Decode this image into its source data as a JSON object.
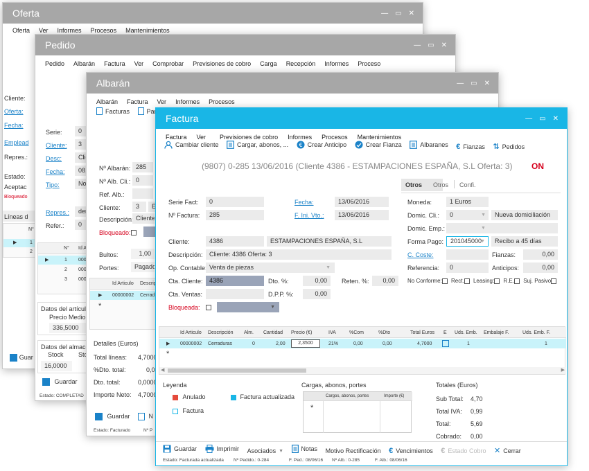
{
  "oferta": {
    "title": "Oferta",
    "menu": [
      "Oferta",
      "Ver",
      "Informes",
      "Procesos",
      "Mantenimientos"
    ],
    "labels": {
      "cliente": "Cliente:",
      "oferta": "Oferta:",
      "fecha": "Fecha:",
      "empleado": "Emplead",
      "repres": "Repres.:",
      "estado": "Estado:",
      "aceptac": "Aceptac",
      "bloqueado": "Bloqueado",
      "lineas": "Líneas d"
    },
    "grid": {
      "header": "N°",
      "rows": [
        "1",
        "2"
      ]
    },
    "guardar": "Guar"
  },
  "pedido": {
    "title": "Pedido",
    "menu": [
      "Pedido",
      "Albarán",
      "Factura",
      "Ver",
      "Comprobar",
      "Previsiones de cobro",
      "Carga",
      "Recepción",
      "Informes",
      "Proceso"
    ],
    "labels": {
      "serie": "Serie:",
      "cliente": "Cliente:",
      "desc": "Desc:",
      "fecha": "Fecha:",
      "tipo": "Tipo:",
      "repres": "Repres.:",
      "refer": "Refer.:"
    },
    "values": {
      "serie": "0",
      "cliente": "3",
      "desc": "Clie",
      "fecha": "08,",
      "tipo": "No",
      "repres": "den",
      "refer": "0"
    },
    "grid": {
      "h1": "N°",
      "h2": "Id A",
      "rows": [
        {
          "n": "1",
          "id": "0000"
        },
        {
          "n": "2",
          "id": "0000"
        },
        {
          "n": "3",
          "id": "0000"
        }
      ]
    },
    "articulo": {
      "title": "Datos del artículo",
      "precio_label": "Precio Medio",
      "precio": "336,5000"
    },
    "almacen": {
      "title": "Datos del almacé",
      "stock_label": "Stock",
      "stock2": "Sto",
      "stock": "16,0000"
    },
    "guardar": "Guardar",
    "status": "Estado: COMPLETAD"
  },
  "albaran": {
    "title": "Albarán",
    "menu": [
      "Albarán",
      "Factura",
      "Ver",
      "Informes",
      "Procesos"
    ],
    "toolbar": [
      "Facturas",
      "Par"
    ],
    "labels": {
      "num": "Nº Albarán:",
      "numcli": "Nº Alb. Cli.:",
      "ref": "Ref. Alb.:",
      "cliente": "Cliente:",
      "desc": "Descripción:",
      "bloq": "Bloqueado:",
      "bultos": "Bultos:",
      "portes": "Portes:"
    },
    "values": {
      "num": "285",
      "numcli": "0",
      "cliente": "3",
      "cliente2": "ES",
      "desc": "Cliente:",
      "bultos": "1,00",
      "portes": "Pagado"
    },
    "grid": {
      "h1": "Id Articulo",
      "h2": "Descrip",
      "row_id": "00000002",
      "row_desc": "Cerrad"
    },
    "detalles": {
      "title": "Detalles (Euros)",
      "rows": [
        {
          "l": "Total líneas:",
          "v": "4,7000"
        },
        {
          "l": "%Dto. total:",
          "v": "0,0"
        },
        {
          "l": "Dto. total:",
          "v": "0,0000"
        },
        {
          "l": "Importe Neto:",
          "v": "4,7000"
        }
      ]
    },
    "guardar": "Guardar",
    "nuevo": "N",
    "status1": "Estado: Facturado",
    "status2": "Nº P"
  },
  "factura": {
    "title": "Factura",
    "menu": [
      "Factura",
      "Ver",
      "Previsiones de cobro",
      "Informes",
      "Procesos",
      "Mantenimientos"
    ],
    "toolbar": [
      "Cambiar cliente",
      "Cargar, abonos, ...",
      "Crear Anticipo",
      "Crear Fianza",
      "Albaranes",
      "Fianzas",
      "Pedidos"
    ],
    "header": "(9807) 0-285  13/06/2016  (Cliente 4386 - ESTAMPACIONES ESPAÑA, S.L   Oferta: 3)",
    "status_on": "ON",
    "tabs": [
      "Otros",
      "Otros",
      "Confi."
    ],
    "fields": {
      "serie_l": "Serie Fact:",
      "serie": "0",
      "nfact_l": "Nº Factura:",
      "nfact": "285",
      "fecha_l": "Fecha:",
      "fecha": "13/06/2016",
      "fini_l": "F. Ini. Vto.:",
      "fini": "13/06/2016",
      "moneda_l": "Moneda:",
      "moneda": "1  Euros",
      "domcli_l": "Domic. Cli.:",
      "domcli": "0",
      "nueva": "Nueva domiciliación",
      "domemp_l": "Domic. Emp.:",
      "cliente_l": "Cliente:",
      "cliente": "4386",
      "cliente_nombre": "ESTAMPACIONES ESPAÑA, S.L",
      "desc_l": "Descripción:",
      "desc": "Cliente: 4386  Oferta: 3",
      "opcont_l": "Op. Contable:",
      "opcont": "Venta de piezas",
      "ctacli_l": "Cta. Cliente:",
      "ctacli": "4386",
      "ctaven_l": "Cta. Ventas:",
      "dto_l": "Dto. %:",
      "dto": "0,00",
      "reten_l": "Reten. %:",
      "reten": "0,00",
      "dpp_l": "D.P.P. %:",
      "dpp": "0,00",
      "bloq_l": "Bloqueada:",
      "formapago_l": "Forma Pago:",
      "formapago": "201045000",
      "recibo": "Recibo a 45 días",
      "ccoste_l": "C. Coste:",
      "fianzas_l": "Fianzas:",
      "fianzas": "0,00",
      "anticipos_l": "Anticipos:",
      "anticipos": "0,00",
      "referencia_l": "Referencia:",
      "referencia": "0",
      "noconforme": "No Conforme:",
      "rect": "Rect.",
      "leasing": "Leasing:",
      "re": "R.E.",
      "sujpasivo": "Suj. Pasivo"
    },
    "grid": {
      "headers": [
        "Id Articulo",
        "Descripción",
        "Alm.",
        "Cantidad",
        "Precio (€)",
        "IVA",
        "%Com",
        "%Dto",
        "Total Euros",
        "E",
        "Uds. Emb.",
        "Embalaje F.",
        "Uds. Emb. F."
      ],
      "row": [
        "00000002",
        "Cerraduras",
        "0",
        "2,00",
        "2,3500",
        "21%",
        "0,00",
        "0,00",
        "4,7000",
        "",
        "1",
        "",
        "1"
      ]
    },
    "leyenda": {
      "title": "Leyenda",
      "anulado": "Anulado",
      "factura": "Factura",
      "actualizada": "Factura actualizada"
    },
    "cargas": {
      "title": "Cargas, abonos, portes",
      "h1": "Cargos, abonos, portes",
      "h2": "Importe (€)"
    },
    "totales": {
      "title": "Totales (Euros)",
      "rows": [
        {
          "l": "Sub Total:",
          "v": "4,70"
        },
        {
          "l": "Total IVA:",
          "v": "0,99"
        },
        {
          "l": "Total:",
          "v": "5,69"
        },
        {
          "l": "Cobrado:",
          "v": "0,00"
        }
      ]
    },
    "bottom": [
      "Guardar",
      "Imprimir",
      "Asociados",
      "Notas",
      "Motivo Rectificación",
      "Vencimientos",
      "Estado Cobro",
      "Cerrar"
    ],
    "status": [
      "Estado: Facturada actualizada",
      "Nº Pedido.: 0-284",
      "F. Ped.: 08/06/16",
      "Nº Alb.: 0-285",
      "F. Alb.: 08/06/16"
    ]
  },
  "colors": {
    "accent": "#19b6e6",
    "titlebar_gray": "#a7a7a7",
    "link": "#1a82c8",
    "red": "#d6001c",
    "row_highlight": "#c9f3fa"
  }
}
